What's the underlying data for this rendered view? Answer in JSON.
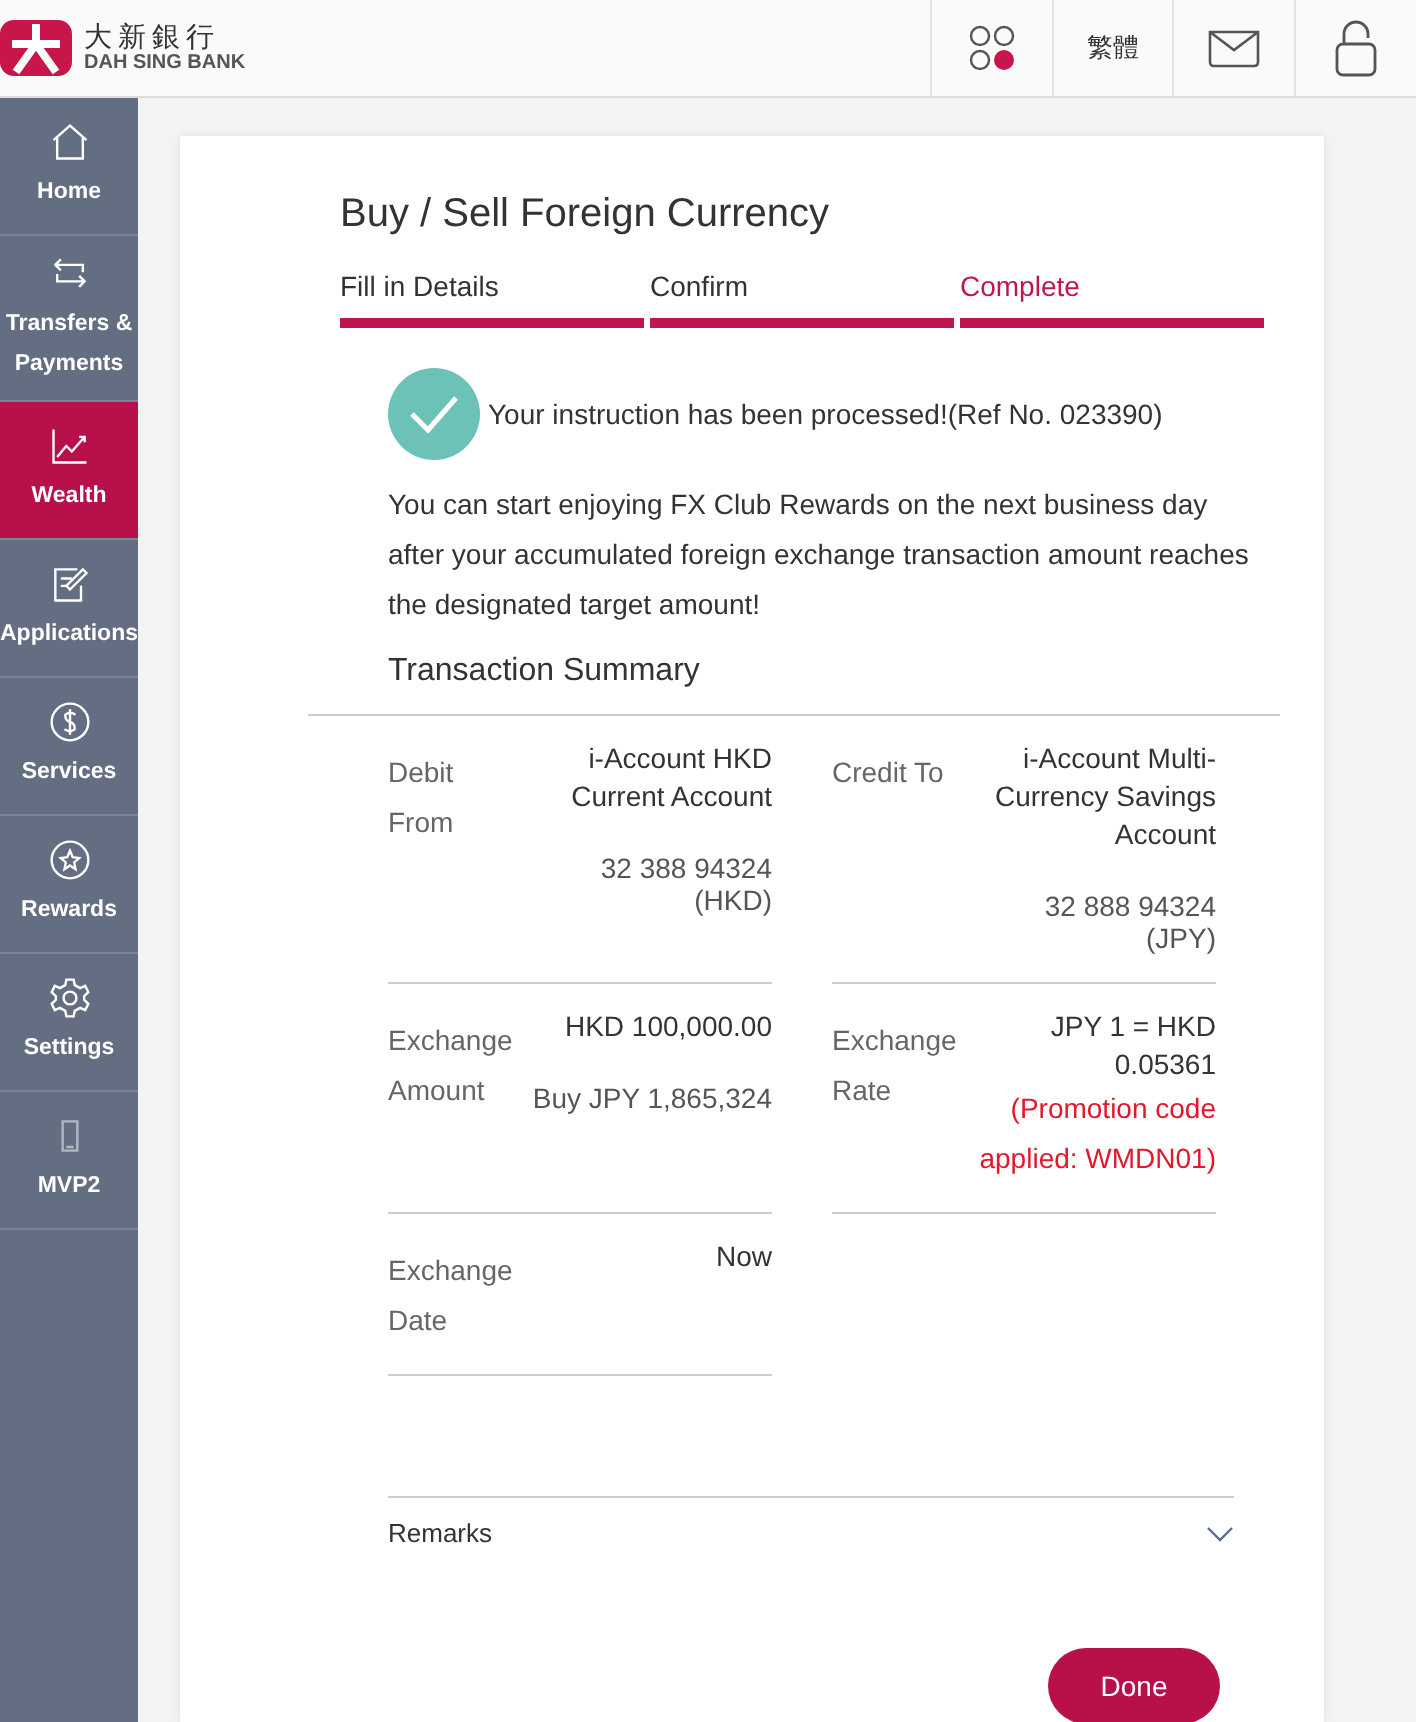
{
  "header": {
    "logo_cn": "大新銀行",
    "logo_en": "DAH SING BANK",
    "language": "繁體"
  },
  "sidebar": {
    "items": [
      {
        "label": "Home",
        "selected": false
      },
      {
        "label": "Transfers & Payments",
        "selected": false
      },
      {
        "label": "Wealth",
        "selected": true
      },
      {
        "label": "Applications",
        "selected": false
      },
      {
        "label": "Services",
        "selected": false
      },
      {
        "label": "Rewards",
        "selected": false
      },
      {
        "label": "Settings",
        "selected": false
      },
      {
        "label": "MVP2",
        "selected": false
      }
    ]
  },
  "page": {
    "title": "Buy / Sell Foreign Currency",
    "steps": [
      {
        "label": "Fill in Details",
        "selected": false
      },
      {
        "label": "Confirm",
        "selected": false
      },
      {
        "label": "Complete",
        "selected": true
      }
    ],
    "status": "Your instruction has been processed!(Ref No. 023390)",
    "message": "You can start enjoying FX Club Rewards on the next business day after your accumulated foreign exchange transaction amount reaches the designated target amount!",
    "summary": {
      "title": "Transaction Summary",
      "fields": [
        {
          "label": "Debit From",
          "value": "i-Account HKD Current Account",
          "detail": "32 388 94324 (HKD)"
        },
        {
          "label": "Credit To",
          "value": "i-Account Multi-Currency Savings Account",
          "detail": "32 888 94324 (JPY)"
        },
        {
          "label": "Exchange Amount",
          "value": "HKD 100,000.00",
          "detail": "Buy JPY 1,865,324"
        },
        {
          "label": "Exchange Rate",
          "value": "JPY 1 = HKD 0.05361",
          "note": "(Promotion code applied: WMDN01)"
        },
        {
          "label": "Exchange Date",
          "value": "Now"
        }
      ]
    },
    "remarks": {
      "label": "Remarks",
      "expanded": false
    },
    "done": "Done"
  }
}
